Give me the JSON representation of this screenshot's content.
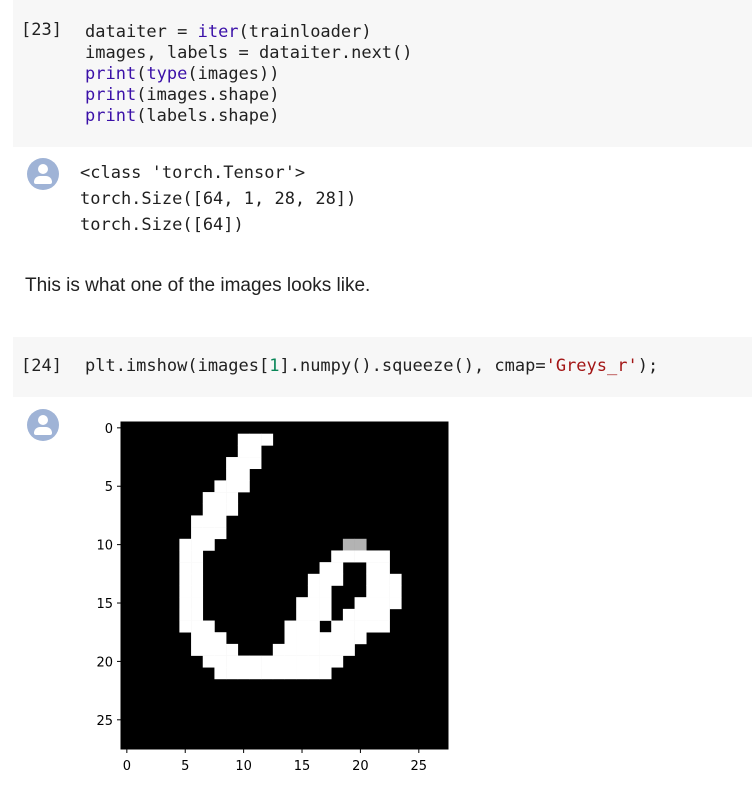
{
  "cells": [
    {
      "prompt": "[23]",
      "code_lines": [
        "dataiter = iter(trainloader)",
        "images, labels = dataiter.next()",
        "print(type(images))",
        "print(images.shape)",
        "print(labels.shape)"
      ],
      "output_lines": [
        "<class 'torch.Tensor'>",
        "torch.Size([64, 1, 28, 28])",
        "torch.Size([64])"
      ]
    },
    {
      "prompt": "[24]",
      "code_lines": [
        "plt.imshow(images[1].numpy().squeeze(), cmap='Greys_r');"
      ]
    }
  ],
  "markdown_text": "This is what one of the images looks like.",
  "colors": {
    "keyword": "#3a10a8",
    "number": "#098658",
    "string": "#a31515",
    "cell_bg": "#f7f7f7",
    "avatar": "#9fb3d6"
  },
  "icons": {
    "output_avatar": "user-avatar-icon"
  },
  "chart_data": {
    "type": "heatmap",
    "colormap": "Greys_r",
    "shape": [
      28,
      28
    ],
    "xticks": [
      0,
      5,
      10,
      15,
      20,
      25
    ],
    "yticks": [
      0,
      5,
      10,
      15,
      20,
      25
    ],
    "grid": false,
    "content": "handwritten digit 6",
    "pixels": [
      {
        "row": 1,
        "segments": [
          [
            10,
            12,
            1.0
          ]
        ]
      },
      {
        "row": 2,
        "segments": [
          [
            10,
            11,
            1.0
          ]
        ]
      },
      {
        "row": 3,
        "segments": [
          [
            9,
            11,
            1.0
          ]
        ]
      },
      {
        "row": 4,
        "segments": [
          [
            9,
            10,
            1.0
          ]
        ]
      },
      {
        "row": 5,
        "segments": [
          [
            8,
            10,
            1.0
          ]
        ]
      },
      {
        "row": 6,
        "segments": [
          [
            7,
            9,
            1.0
          ]
        ]
      },
      {
        "row": 7,
        "segments": [
          [
            7,
            9,
            1.0
          ]
        ]
      },
      {
        "row": 8,
        "segments": [
          [
            6,
            8,
            1.0
          ]
        ]
      },
      {
        "row": 9,
        "segments": [
          [
            6,
            8,
            1.0
          ]
        ]
      },
      {
        "row": 10,
        "segments": [
          [
            5,
            7,
            1.0
          ],
          [
            19,
            20,
            0.7
          ]
        ]
      },
      {
        "row": 11,
        "segments": [
          [
            5,
            6,
            1.0
          ],
          [
            18,
            22,
            1.0
          ]
        ]
      },
      {
        "row": 12,
        "segments": [
          [
            5,
            6,
            1.0
          ],
          [
            17,
            18,
            1.0
          ],
          [
            21,
            22,
            1.0
          ]
        ]
      },
      {
        "row": 13,
        "segments": [
          [
            5,
            6,
            1.0
          ],
          [
            16,
            18,
            1.0
          ],
          [
            21,
            23,
            1.0
          ]
        ]
      },
      {
        "row": 14,
        "segments": [
          [
            5,
            6,
            1.0
          ],
          [
            16,
            17,
            1.0
          ],
          [
            21,
            23,
            1.0
          ]
        ]
      },
      {
        "row": 15,
        "segments": [
          [
            5,
            6,
            1.0
          ],
          [
            15,
            17,
            1.0
          ],
          [
            20,
            23,
            1.0
          ]
        ]
      },
      {
        "row": 16,
        "segments": [
          [
            5,
            6,
            1.0
          ],
          [
            15,
            17,
            1.0
          ],
          [
            19,
            22,
            1.0
          ]
        ]
      },
      {
        "row": 17,
        "segments": [
          [
            5,
            7,
            1.0
          ],
          [
            14,
            16,
            1.0
          ],
          [
            18,
            22,
            1.0
          ]
        ]
      },
      {
        "row": 18,
        "segments": [
          [
            6,
            8,
            1.0
          ],
          [
            14,
            20,
            1.0
          ]
        ]
      },
      {
        "row": 19,
        "segments": [
          [
            6,
            9,
            1.0
          ],
          [
            13,
            19,
            1.0
          ]
        ]
      },
      {
        "row": 20,
        "segments": [
          [
            7,
            18,
            1.0
          ]
        ]
      },
      {
        "row": 21,
        "segments": [
          [
            8,
            17,
            1.0
          ]
        ]
      }
    ]
  }
}
